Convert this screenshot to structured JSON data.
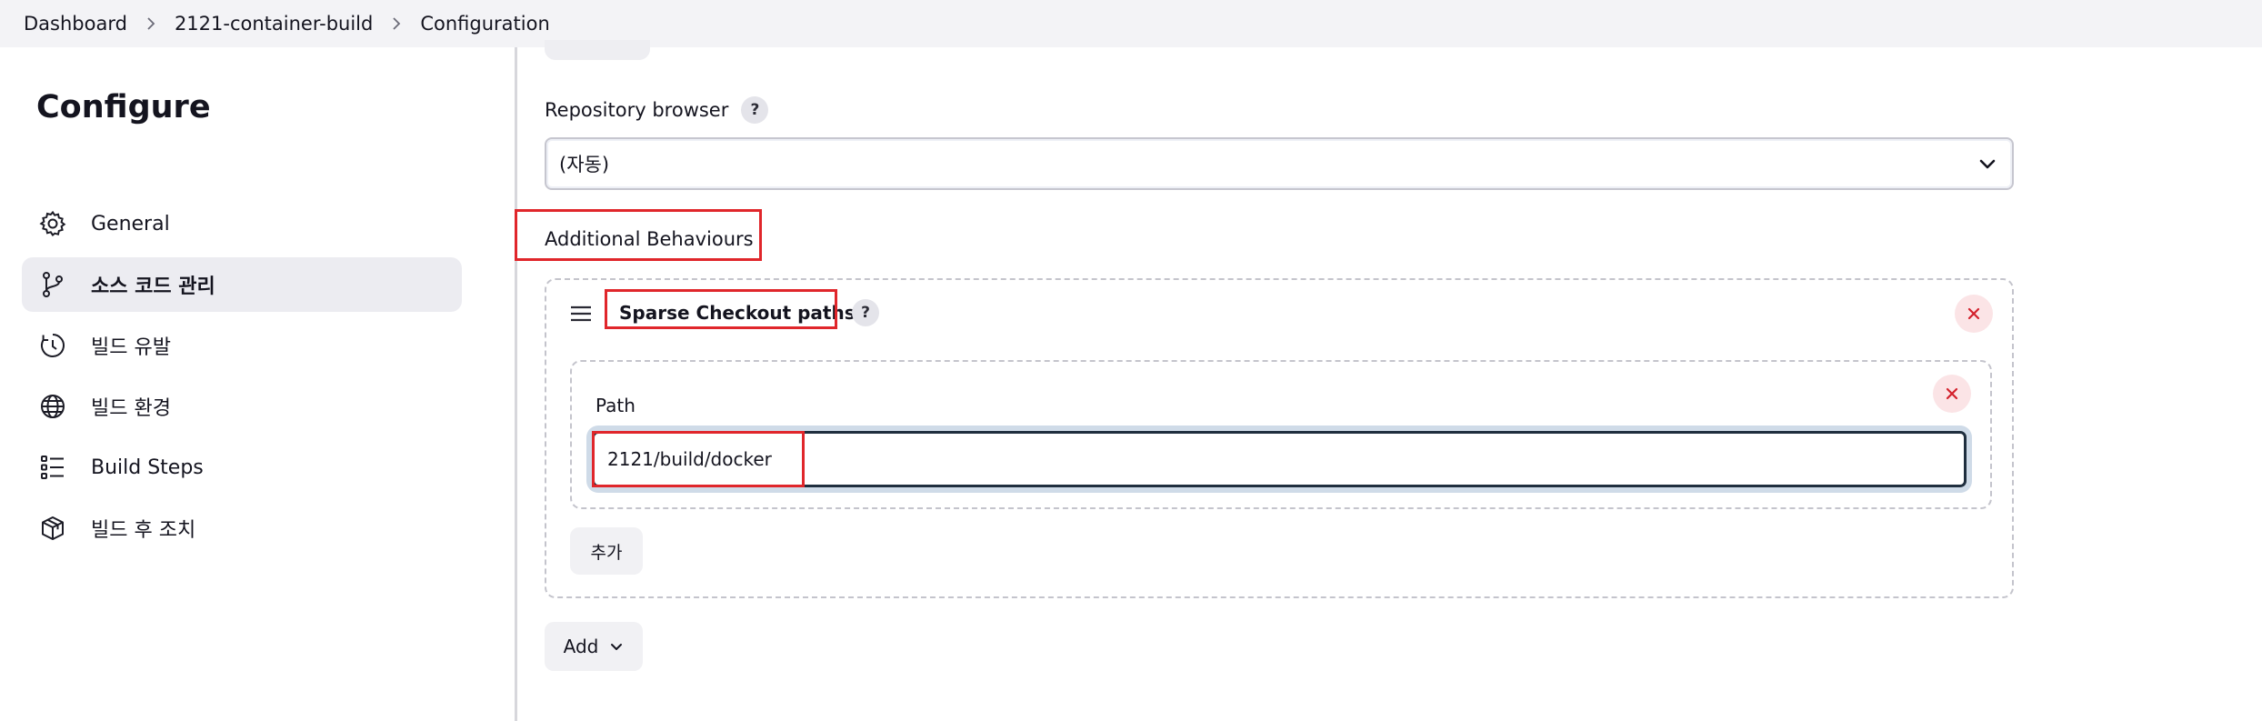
{
  "breadcrumb": {
    "items": [
      "Dashboard",
      "2121-container-build",
      "Configuration"
    ]
  },
  "sidebar": {
    "title": "Configure",
    "items": [
      {
        "label": "General",
        "icon": "gear-icon"
      },
      {
        "label": "소스 코드 관리",
        "icon": "branch-icon",
        "active": true
      },
      {
        "label": "빌드 유발",
        "icon": "clock-icon"
      },
      {
        "label": "빌드 환경",
        "icon": "globe-icon"
      },
      {
        "label": "Build Steps",
        "icon": "list-icon"
      },
      {
        "label": "빌드 후 조치",
        "icon": "package-icon"
      }
    ]
  },
  "main": {
    "repository_browser": {
      "label": "Repository browser",
      "help": "?",
      "selected": "(자동)"
    },
    "additional_behaviours_label": "Additional Behaviours",
    "sparse_checkout": {
      "title": "Sparse Checkout paths",
      "help": "?",
      "path_label": "Path",
      "path_value": "2121/build/docker",
      "add_label": "추가"
    },
    "add_button_label": "Add"
  },
  "colors": {
    "highlight_red": "#e0262b",
    "active_nav_bg": "#ececf1",
    "close_button_bg": "#fbe4e6",
    "close_icon": "#d3212c",
    "focus_ring": "#cfdbe8"
  }
}
